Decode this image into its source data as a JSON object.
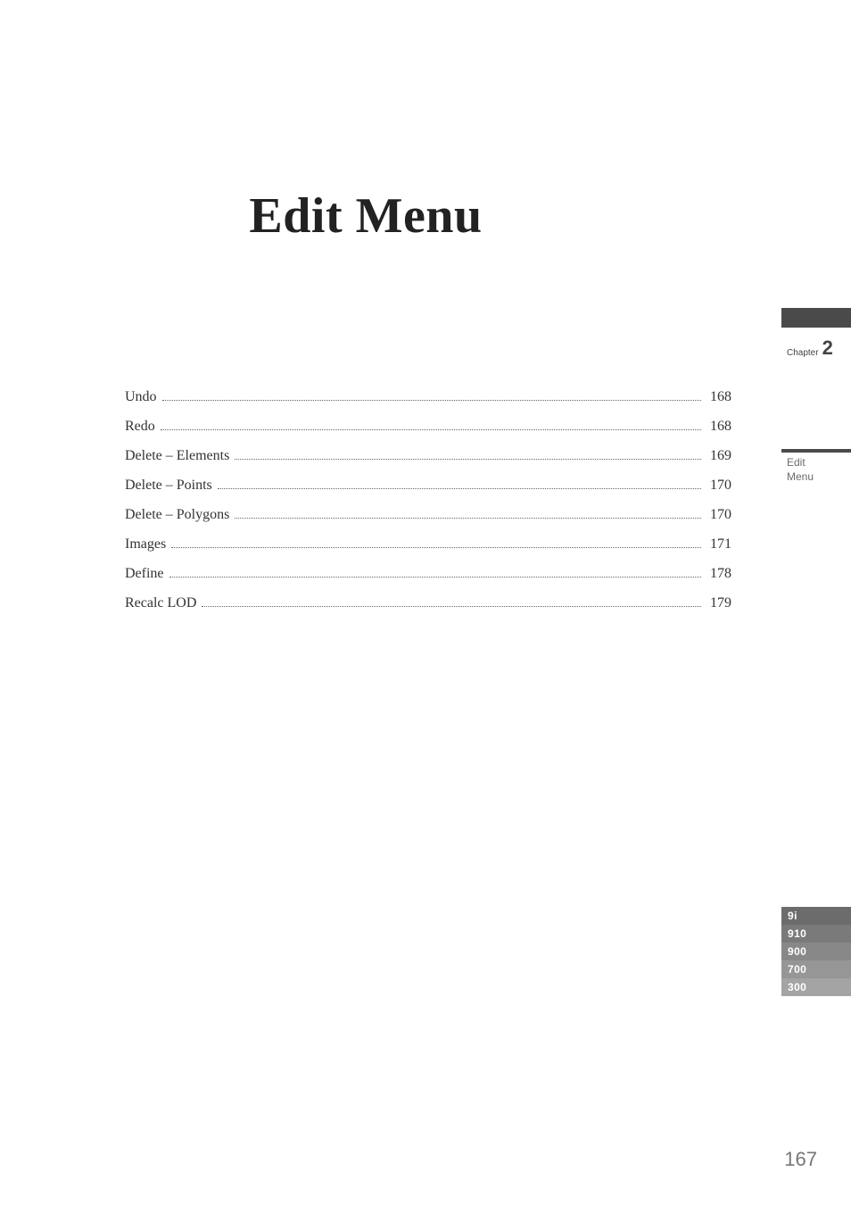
{
  "title": "Edit Menu",
  "toc": [
    {
      "label": "Undo",
      "page": "168"
    },
    {
      "label": "Redo",
      "page": "168"
    },
    {
      "label": "Delete – Elements",
      "page": "169"
    },
    {
      "label": "Delete – Points",
      "page": "170"
    },
    {
      "label": "Delete – Polygons",
      "page": "170"
    },
    {
      "label": "Images",
      "page": "171"
    },
    {
      "label": "Define",
      "page": "178"
    },
    {
      "label": "Recalc LOD",
      "page": "179"
    }
  ],
  "side_tab": {
    "chapter_word": "Chapter",
    "chapter_number": "2"
  },
  "section_label_line1": "Edit",
  "section_label_line2": "Menu",
  "model_tabs": [
    "9i",
    "910",
    "900",
    "700",
    "300"
  ],
  "page_number": "167"
}
